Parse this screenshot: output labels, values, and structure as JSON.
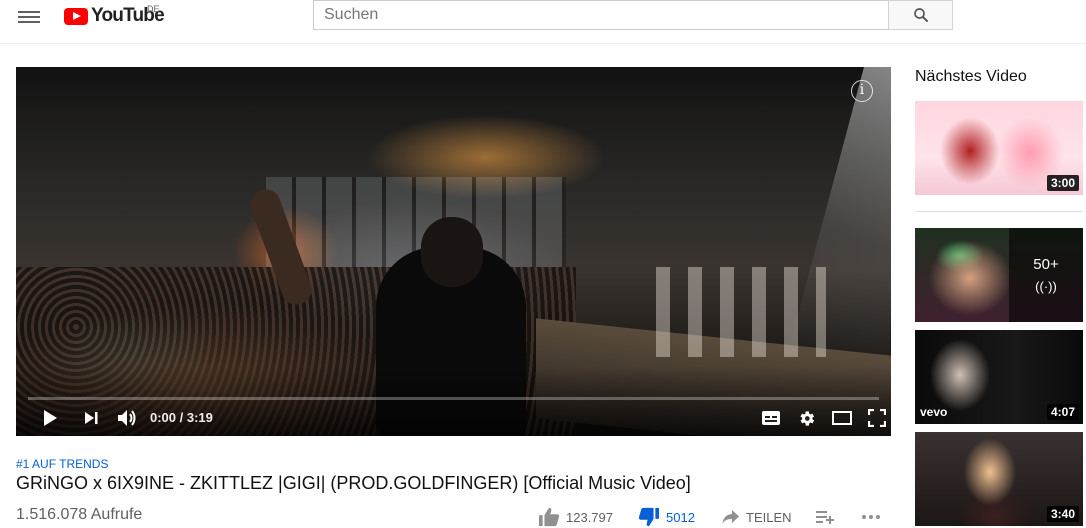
{
  "header": {
    "logo_text": "YouTube",
    "country_code": "DE",
    "search_placeholder": "Suchen"
  },
  "player": {
    "time_display": "0:00 / 3:19",
    "progress": 0.0,
    "info_glyph": "i"
  },
  "video": {
    "trend_label": "#1 AUF TRENDS",
    "title": "GRiNGO x 6IX9INE - ZKITTLEZ |GIGI| (PROD.GOLDFINGER) [Official Music Video]",
    "views": "1.516.078 Aufrufe",
    "likes": "123.797",
    "dislikes": "5012",
    "share_label": "TEILEN"
  },
  "sidebar": {
    "up_next_label": "Nächstes Video",
    "items": [
      {
        "duration": "3:00"
      },
      {
        "mix_count": "50+",
        "mix_icon": "((·))"
      },
      {
        "duration": "4:07",
        "channel_badge": "vevo"
      },
      {
        "duration": "3:40"
      }
    ]
  },
  "colors": {
    "brand_red": "#ff0000",
    "link_blue": "#065fd4",
    "dislike_active": "#065fd4"
  },
  "icons": [
    "menu-icon",
    "youtube-logo-icon",
    "search-icon",
    "info-icon",
    "play-icon",
    "next-icon",
    "volume-icon",
    "subtitles-icon",
    "settings-icon",
    "theater-icon",
    "fullscreen-icon",
    "thumbs-up-icon",
    "thumbs-down-icon",
    "share-icon",
    "add-to-playlist-icon",
    "more-icon"
  ]
}
